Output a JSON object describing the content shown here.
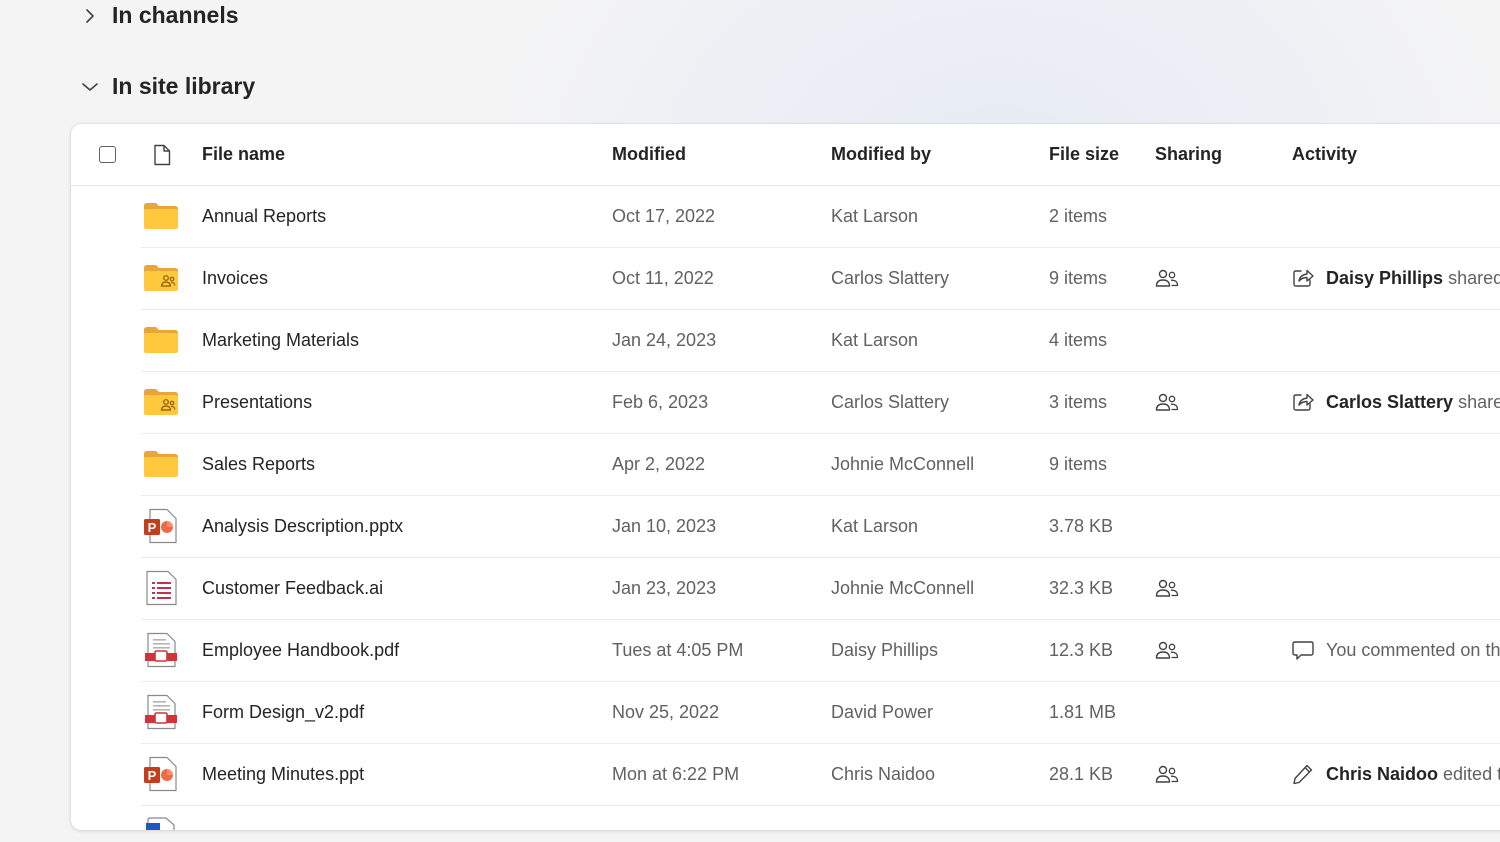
{
  "sections": {
    "channels": {
      "label": "In channels",
      "expanded": false
    },
    "library": {
      "label": "In site library",
      "expanded": true
    }
  },
  "table": {
    "headers": {
      "file_name": "File name",
      "modified": "Modified",
      "modified_by": "Modified by",
      "file_size": "File size",
      "sharing": "Sharing",
      "activity": "Activity"
    },
    "rows": [
      {
        "icon": "folder-icon",
        "name": "Annual Reports",
        "modified": "Oct 17, 2022",
        "modified_by": "Kat Larson",
        "size": "2 items",
        "shared": false,
        "activity_icon": "",
        "activity_person": "",
        "activity_text": ""
      },
      {
        "icon": "shared-folder-icon",
        "name": "Invoices",
        "modified": "Oct 11, 2022",
        "modified_by": "Carlos Slattery",
        "size": "9 items",
        "shared": true,
        "activity_icon": "share-icon",
        "activity_person": "Daisy Phillips",
        "activity_text": "shared t"
      },
      {
        "icon": "folder-icon",
        "name": "Marketing Materials",
        "modified": "Jan 24, 2023",
        "modified_by": "Kat Larson",
        "size": "4 items",
        "shared": false,
        "activity_icon": "",
        "activity_person": "",
        "activity_text": ""
      },
      {
        "icon": "shared-folder-icon",
        "name": "Presentations",
        "modified": "Feb 6, 2023",
        "modified_by": "Carlos Slattery",
        "size": "3 items",
        "shared": true,
        "activity_icon": "share-icon",
        "activity_person": "Carlos Slattery",
        "activity_text": "shared"
      },
      {
        "icon": "folder-icon",
        "name": "Sales Reports",
        "modified": "Apr 2, 2022",
        "modified_by": "Johnie McConnell",
        "size": "9 items",
        "shared": false,
        "activity_icon": "",
        "activity_person": "",
        "activity_text": ""
      },
      {
        "icon": "powerpoint-file-icon",
        "name": "Analysis Description.pptx",
        "modified": "Jan 10, 2023",
        "modified_by": "Kat Larson",
        "size": "3.78 KB",
        "shared": false,
        "activity_icon": "",
        "activity_person": "",
        "activity_text": ""
      },
      {
        "icon": "text-file-icon",
        "name": "Customer Feedback.ai",
        "modified": "Jan 23, 2023",
        "modified_by": "Johnie McConnell",
        "size": "32.3 KB",
        "shared": true,
        "activity_icon": "",
        "activity_person": "",
        "activity_text": ""
      },
      {
        "icon": "pdf-file-icon",
        "name": "Employee Handbook.pdf",
        "modified": "Tues at 4:05 PM",
        "modified_by": "Daisy Phillips",
        "size": "12.3 KB",
        "shared": true,
        "activity_icon": "comment-icon",
        "activity_person": "",
        "activity_text": "You commented on th"
      },
      {
        "icon": "pdf-file-icon",
        "name": "Form Design_v2.pdf",
        "modified": "Nov 25, 2022",
        "modified_by": "David Power",
        "size": "1.81 MB",
        "shared": false,
        "activity_icon": "",
        "activity_person": "",
        "activity_text": ""
      },
      {
        "icon": "powerpoint-file-icon",
        "name": "Meeting Minutes.ppt",
        "modified": "Mon at 6:22 PM",
        "modified_by": "Chris Naidoo",
        "size": "28.1 KB",
        "shared": true,
        "activity_icon": "edit-icon",
        "activity_person": "Chris Naidoo",
        "activity_text": "edited t"
      }
    ]
  },
  "colors": {
    "folder": "#ffc83d",
    "folder_tab": "#e8a53a",
    "powerpoint": "#c43e1c",
    "pdf": "#d13438",
    "accent": "#0f6cbd"
  }
}
